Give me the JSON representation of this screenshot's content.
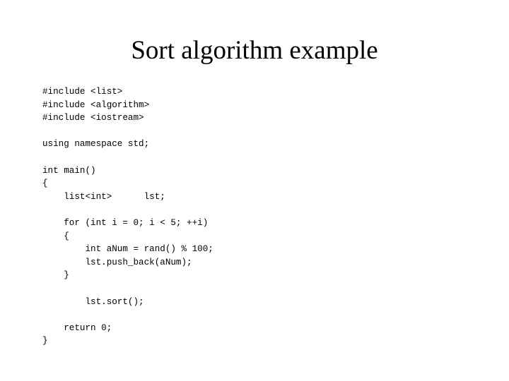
{
  "slide": {
    "title": "Sort algorithm example",
    "background_color": "#ffffff",
    "text_color": "#000000"
  },
  "code": {
    "language": "cpp",
    "lines": [
      "#include <list>",
      "#include <algorithm>",
      "#include <iostream>",
      "",
      "using namespace std;",
      "",
      "int main()",
      "{",
      "    list<int>      lst;",
      "",
      "    for (int i = 0; i < 5; ++i)",
      "    {",
      "        int aNum = rand() % 100;",
      "        lst.push_back(aNum);",
      "    }",
      "",
      "        lst.sort();",
      "",
      "    return 0;",
      "}"
    ]
  }
}
